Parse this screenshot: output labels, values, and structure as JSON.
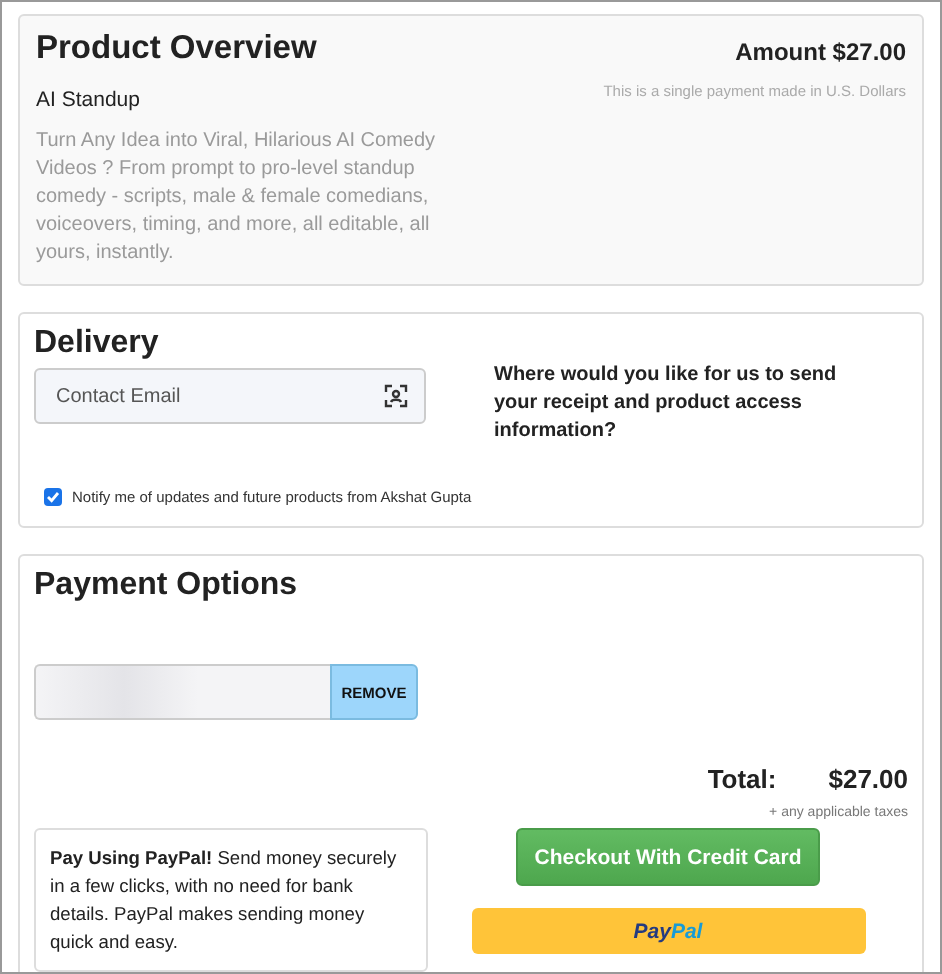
{
  "product_overview": {
    "title": "Product Overview",
    "product_name": "AI Standup",
    "description": "Turn Any Idea into Viral, Hilarious AI Comedy Videos ? From prompt to pro-level standup comedy - scripts, male & female comedians, voiceovers, timing, and more, all editable, all yours, instantly.",
    "amount": "Amount $27.00",
    "payment_note": "This is a single payment made in U.S. Dollars"
  },
  "delivery": {
    "title": "Delivery",
    "email_field": {
      "placeholder": "Contact Email"
    },
    "prompt": "Where would you like for us to send your receipt and product access information?",
    "notify": {
      "label": "Notify me of updates and future products from Akshat Gupta",
      "checked": true
    }
  },
  "payment_options": {
    "title": "Payment Options",
    "remove_button": "REMOVE",
    "total_label": "Total:",
    "total_value": "$27.00",
    "taxes_note": "+ any applicable taxes",
    "paypal_info": "**Pay Using PayPal!** Send money securely in a few clicks, with no need for bank details. PayPal makes sending money quick and easy.",
    "checkout_button": "Checkout With Credit Card",
    "paypal_button": {
      "label_parts": [
        "Pay",
        "Pal"
      ]
    }
  }
}
